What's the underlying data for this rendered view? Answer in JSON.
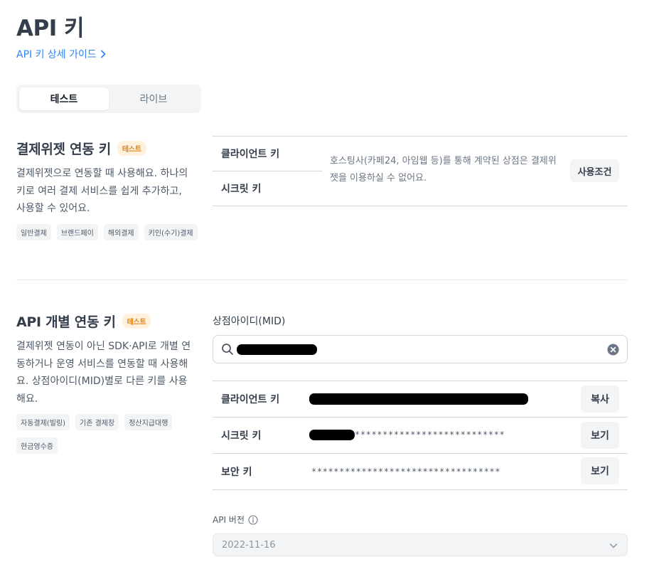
{
  "page": {
    "title": "API 키",
    "guide_link": "API 키 상세 가이드"
  },
  "env_tabs": [
    {
      "label": "테스트",
      "active": true
    },
    {
      "label": "라이브",
      "active": false
    }
  ],
  "widget_section": {
    "title": "결제위젯 연동 키",
    "badge": "테스트",
    "description": "결제위젯으로 연동할 때 사용해요. 하나의 키로 여러 결제 서비스를 쉽게 추가하고, 사용할 수 있어요.",
    "chips": [
      "일반결제",
      "브랜드페이",
      "해외결제",
      "키인(수기)결제"
    ],
    "client_key_label": "클라이언트 키",
    "secret_key_label": "시크릿 키",
    "notice": "호스팅사(카페24, 아임웹 등)를 통해 계약된 상점은 결제위젯을 이용하실 수 없어요.",
    "terms_button": "사용조건"
  },
  "api_section": {
    "title": "API 개별 연동 키",
    "badge": "테스트",
    "description": "결제위젯 연동이 아닌 SDK·API로 개별 연동하거나 운영 서비스를 연동할 때 사용해요. 상점아이디(MID)별로 다른 키를 사용해요.",
    "chips": [
      "자동결제(빌링)",
      "기존 결제창",
      "정산지급대행",
      "현금영수증"
    ],
    "mid_label": "상점아이디(MID)",
    "keys": [
      {
        "label": "클라이언트 키",
        "value": "",
        "button": "복사"
      },
      {
        "label": "시크릿 키",
        "value": "***************************",
        "button": "보기"
      },
      {
        "label": "보안 키",
        "value": "**********************************",
        "button": "보기"
      }
    ],
    "api_version_label": "API 버전",
    "api_version_value": "2022-11-16"
  },
  "colors": {
    "accent_blue": "#3182f6",
    "badge_orange": "#e0831b",
    "badge_bg": "#fff1dd"
  }
}
